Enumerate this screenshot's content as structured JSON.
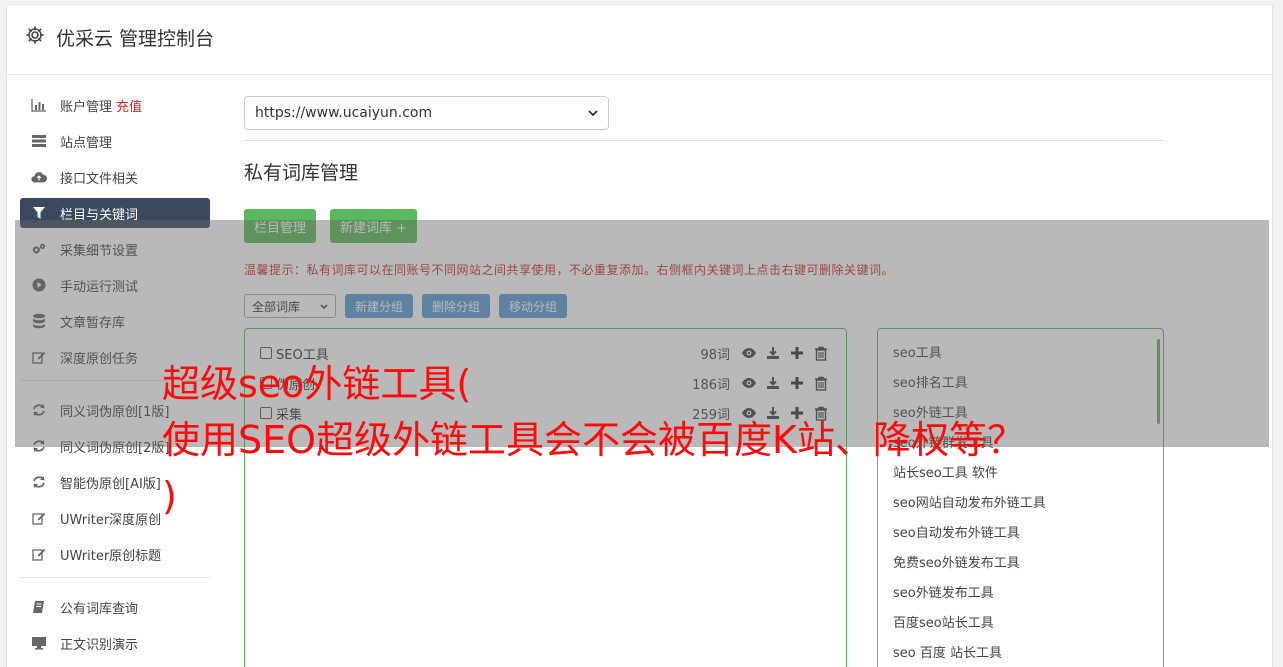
{
  "header": {
    "title": "优采云 管理控制台"
  },
  "sidebar": {
    "items": [
      {
        "label": "账户管理",
        "badge": "充值",
        "icon": "bar-chart-icon"
      },
      {
        "label": "站点管理",
        "icon": "server-icon"
      },
      {
        "label": "接口文件相关",
        "icon": "cloud-upload-icon"
      },
      {
        "label": "栏目与关键词",
        "icon": "filter-icon"
      },
      {
        "label": "采集细节设置",
        "icon": "gears-icon"
      },
      {
        "label": "手动运行测试",
        "icon": "play-circle-icon"
      },
      {
        "label": "文章暂存库",
        "icon": "database-icon"
      },
      {
        "label": "深度原创任务",
        "icon": "edit-icon"
      },
      {
        "label": "同义词伪原创[1版]",
        "icon": "refresh-icon"
      },
      {
        "label": "同义词伪原创[2版]",
        "icon": "refresh-icon"
      },
      {
        "label": "智能伪原创[AI版]",
        "icon": "refresh-icon"
      },
      {
        "label": "UWriter深度原创",
        "icon": "edit-icon"
      },
      {
        "label": "UWriter原创标题",
        "icon": "edit-icon"
      },
      {
        "label": "公有词库查询",
        "icon": "book-icon"
      },
      {
        "label": "正文识别演示",
        "icon": "monitor-icon"
      }
    ]
  },
  "site_select": {
    "value": "https://www.ucaiyun.com"
  },
  "section_title": "私有词库管理",
  "buttons": {
    "column_manage": "栏目管理",
    "new_library": "新建词库 +"
  },
  "tip": "温馨提示：私有词库可以在同账号不同网站之间共享使用，不必重复添加。右侧框内关键词上点击右键可删除关键词。",
  "group_bar": {
    "select_value": "全部词库",
    "new_group": "新建分组",
    "delete_group": "删除分组",
    "move_group": "移动分组"
  },
  "libraries": [
    {
      "name": "SEO工具",
      "count": "98词"
    },
    {
      "name": "伪原创",
      "count": "186词"
    },
    {
      "name": "采集",
      "count": "259词"
    }
  ],
  "keywords": [
    "seo工具",
    "seo排名工具",
    "seo外链工具",
    "seo外链群发工具",
    "站长seo工具 软件",
    "seo网站自动发布外链工具",
    "seo自动发布外链工具",
    "免费seo外链发布工具",
    "seo外链发布工具",
    "百度seo站长工具",
    "seo 百度 站长工具"
  ],
  "overlay_text": {
    "line1": "超级seo外链工具(",
    "line2": "使用SEO超级外链工具会不会被百度K站、降权等？",
    "line3": ")"
  }
}
